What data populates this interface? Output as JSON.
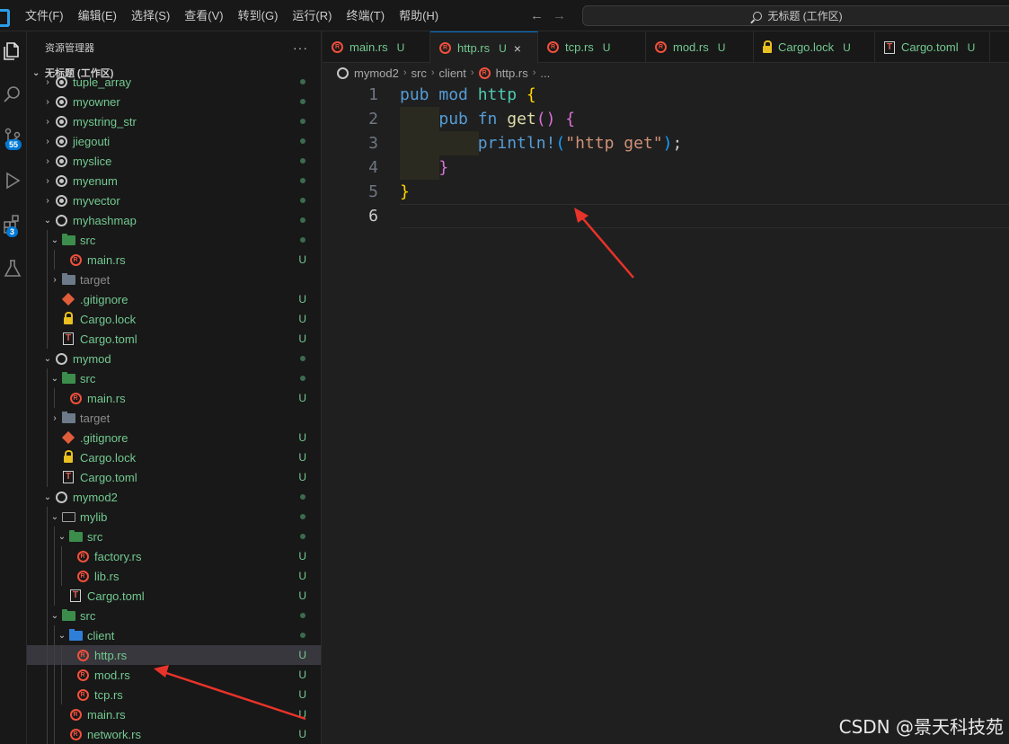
{
  "menubar": {
    "items": [
      "文件(F)",
      "编辑(E)",
      "选择(S)",
      "查看(V)",
      "转到(G)",
      "运行(R)",
      "终端(T)",
      "帮助(H)"
    ]
  },
  "nav": {
    "back_icon": "arrow-left-icon",
    "forward_icon": "arrow-right-icon"
  },
  "command_center": {
    "label": "无标题 (工作区)"
  },
  "activity_bar": {
    "source_control_badge": "55",
    "extensions_badge": "3"
  },
  "sidebar": {
    "title": "资源管理器",
    "more": "···",
    "workspace_title": "无标题 (工作区)"
  },
  "tree": [
    {
      "label": "tuple_array",
      "icon": "module-filled",
      "depth": 0,
      "twisty": "›",
      "status": "dot"
    },
    {
      "label": "myowner",
      "icon": "module-filled",
      "depth": 0,
      "twisty": "›",
      "status": "dot"
    },
    {
      "label": "mystring_str",
      "icon": "module-filled",
      "depth": 0,
      "twisty": "›",
      "status": "dot"
    },
    {
      "label": "jiegouti",
      "icon": "module-filled",
      "depth": 0,
      "twisty": "›",
      "status": "dot"
    },
    {
      "label": "myslice",
      "icon": "module-filled",
      "depth": 0,
      "twisty": "›",
      "status": "dot"
    },
    {
      "label": "myenum",
      "icon": "module-filled",
      "depth": 0,
      "twisty": "›",
      "status": "dot"
    },
    {
      "label": "myvector",
      "icon": "module-filled",
      "depth": 0,
      "twisty": "›",
      "status": "dot"
    },
    {
      "label": "myhashmap",
      "icon": "module",
      "depth": 0,
      "twisty": "⌄",
      "status": "dot"
    },
    {
      "label": "src",
      "icon": "folder-src",
      "depth": 1,
      "twisty": "⌄",
      "status": "dot"
    },
    {
      "label": "main.rs",
      "icon": "rust",
      "depth": 2,
      "twisty": "",
      "status": "U"
    },
    {
      "label": "target",
      "icon": "folder-target",
      "depth": 1,
      "twisty": "›",
      "status": "",
      "dim": true
    },
    {
      "label": ".gitignore",
      "icon": "git",
      "depth": 1,
      "twisty": "",
      "status": "U"
    },
    {
      "label": "Cargo.lock",
      "icon": "lock",
      "depth": 1,
      "twisty": "",
      "status": "U"
    },
    {
      "label": "Cargo.toml",
      "icon": "toml",
      "depth": 1,
      "twisty": "",
      "status": "U"
    },
    {
      "label": "mymod",
      "icon": "module",
      "depth": 0,
      "twisty": "⌄",
      "status": "dot"
    },
    {
      "label": "src",
      "icon": "folder-src",
      "depth": 1,
      "twisty": "⌄",
      "status": "dot"
    },
    {
      "label": "main.rs",
      "icon": "rust",
      "depth": 2,
      "twisty": "",
      "status": "U"
    },
    {
      "label": "target",
      "icon": "folder-target",
      "depth": 1,
      "twisty": "›",
      "status": "",
      "dim": true
    },
    {
      "label": ".gitignore",
      "icon": "git",
      "depth": 1,
      "twisty": "",
      "status": "U"
    },
    {
      "label": "Cargo.lock",
      "icon": "lock",
      "depth": 1,
      "twisty": "",
      "status": "U"
    },
    {
      "label": "Cargo.toml",
      "icon": "toml",
      "depth": 1,
      "twisty": "",
      "status": "U"
    },
    {
      "label": "mymod2",
      "icon": "module",
      "depth": 0,
      "twisty": "⌄",
      "status": "dot"
    },
    {
      "label": "mylib",
      "icon": "folder-plain",
      "depth": 1,
      "twisty": "⌄",
      "status": "dot"
    },
    {
      "label": "src",
      "icon": "folder-src",
      "depth": 2,
      "twisty": "⌄",
      "status": "dot"
    },
    {
      "label": "factory.rs",
      "icon": "rust",
      "depth": 3,
      "twisty": "",
      "status": "U"
    },
    {
      "label": "lib.rs",
      "icon": "rust",
      "depth": 3,
      "twisty": "",
      "status": "U"
    },
    {
      "label": "Cargo.toml",
      "icon": "toml",
      "depth": 2,
      "twisty": "",
      "status": "U"
    },
    {
      "label": "src",
      "icon": "folder-src",
      "depth": 1,
      "twisty": "⌄",
      "status": "dot"
    },
    {
      "label": "client",
      "icon": "folder-client",
      "depth": 2,
      "twisty": "⌄",
      "status": "dot"
    },
    {
      "label": "http.rs",
      "icon": "rust",
      "depth": 3,
      "twisty": "",
      "status": "U",
      "selected": true
    },
    {
      "label": "mod.rs",
      "icon": "rust",
      "depth": 3,
      "twisty": "",
      "status": "U"
    },
    {
      "label": "tcp.rs",
      "icon": "rust",
      "depth": 3,
      "twisty": "",
      "status": "U"
    },
    {
      "label": "main.rs",
      "icon": "rust",
      "depth": 2,
      "twisty": "",
      "status": "U"
    },
    {
      "label": "network.rs",
      "icon": "rust",
      "depth": 2,
      "twisty": "",
      "status": "U"
    }
  ],
  "tabs": [
    {
      "label": "main.rs",
      "icon": "rust",
      "status": "U",
      "active": false
    },
    {
      "label": "http.rs",
      "icon": "rust",
      "status": "U",
      "active": true,
      "close": "×"
    },
    {
      "label": "tcp.rs",
      "icon": "rust",
      "status": "U",
      "active": false
    },
    {
      "label": "mod.rs",
      "icon": "rust",
      "status": "U",
      "active": false
    },
    {
      "label": "Cargo.lock",
      "icon": "lock",
      "status": "U",
      "active": false
    },
    {
      "label": "Cargo.toml",
      "icon": "toml",
      "status": "U",
      "active": false
    }
  ],
  "breadcrumb": {
    "items": [
      "mymod2",
      "src",
      "client",
      "http.rs",
      "..."
    ]
  },
  "editor": {
    "line_numbers": [
      "1",
      "2",
      "3",
      "4",
      "5",
      "6"
    ],
    "current_line": "6",
    "lines": [
      [
        {
          "t": "pub",
          "c": "kw"
        },
        {
          "t": " ",
          "c": "pl"
        },
        {
          "t": "mod",
          "c": "kw"
        },
        {
          "t": " ",
          "c": "pl"
        },
        {
          "t": "http",
          "c": "ty"
        },
        {
          "t": " ",
          "c": "pl"
        },
        {
          "t": "{",
          "c": "br1"
        }
      ],
      [
        {
          "t": "    ",
          "c": "pl"
        },
        {
          "t": "pub",
          "c": "kw"
        },
        {
          "t": " ",
          "c": "pl"
        },
        {
          "t": "fn",
          "c": "kw"
        },
        {
          "t": " ",
          "c": "pl"
        },
        {
          "t": "get",
          "c": "fn"
        },
        {
          "t": "()",
          "c": "br2"
        },
        {
          "t": " ",
          "c": "pl"
        },
        {
          "t": "{",
          "c": "br2"
        }
      ],
      [
        {
          "t": "        ",
          "c": "pl"
        },
        {
          "t": "println!",
          "c": "mac"
        },
        {
          "t": "(",
          "c": "br3"
        },
        {
          "t": "\"http get\"",
          "c": "str"
        },
        {
          "t": ")",
          "c": "br3"
        },
        {
          "t": ";",
          "c": "pl"
        }
      ],
      [
        {
          "t": "    ",
          "c": "pl"
        },
        {
          "t": "}",
          "c": "br2"
        }
      ],
      [
        {
          "t": "}",
          "c": "br1"
        }
      ],
      []
    ]
  },
  "watermark": "CSDN @景天科技苑",
  "colors": {
    "accent": "#0078d4",
    "untracked": "#73c991",
    "annotation_arrow": "#e8332a"
  }
}
